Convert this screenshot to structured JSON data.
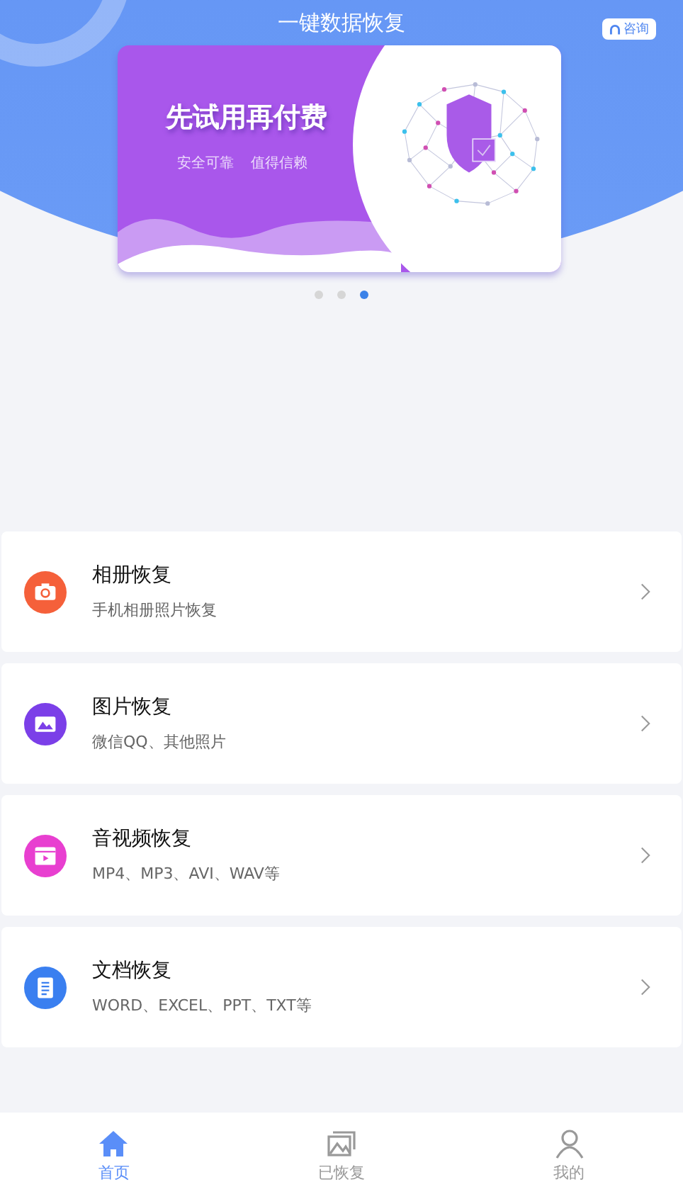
{
  "header": {
    "title": "一键数据恢复",
    "consult_button": "咨询"
  },
  "banner": {
    "headline": "先试用再付费",
    "tagline_1": "安全可靠",
    "tagline_2": "值得信赖"
  },
  "carousel_dots": [
    {
      "selected": false
    },
    {
      "selected": false
    },
    {
      "selected": true
    }
  ],
  "recovery_items": [
    {
      "kind": "album",
      "title": "相册恢复",
      "subtitle": "手机相册照片恢复",
      "color": "#f5603a"
    },
    {
      "kind": "image",
      "title": "图片恢复",
      "subtitle": "微信QQ、其他照片",
      "color": "#7b3fe8"
    },
    {
      "kind": "video",
      "title": "音视频恢复",
      "subtitle": "MP4、MP3、AVI、WAV等",
      "color": "#e83fd0"
    },
    {
      "kind": "document",
      "title": "文档恢复",
      "subtitle": "WORD、EXCEL、PPT、TXT等",
      "color": "#3a7ff0"
    }
  ],
  "tab_bar": [
    {
      "kind": "home",
      "label": "首页",
      "selected": true
    },
    {
      "kind": "recovered",
      "label": "已恢复",
      "selected": false
    },
    {
      "kind": "profile",
      "label": "我的",
      "selected": false
    }
  ]
}
